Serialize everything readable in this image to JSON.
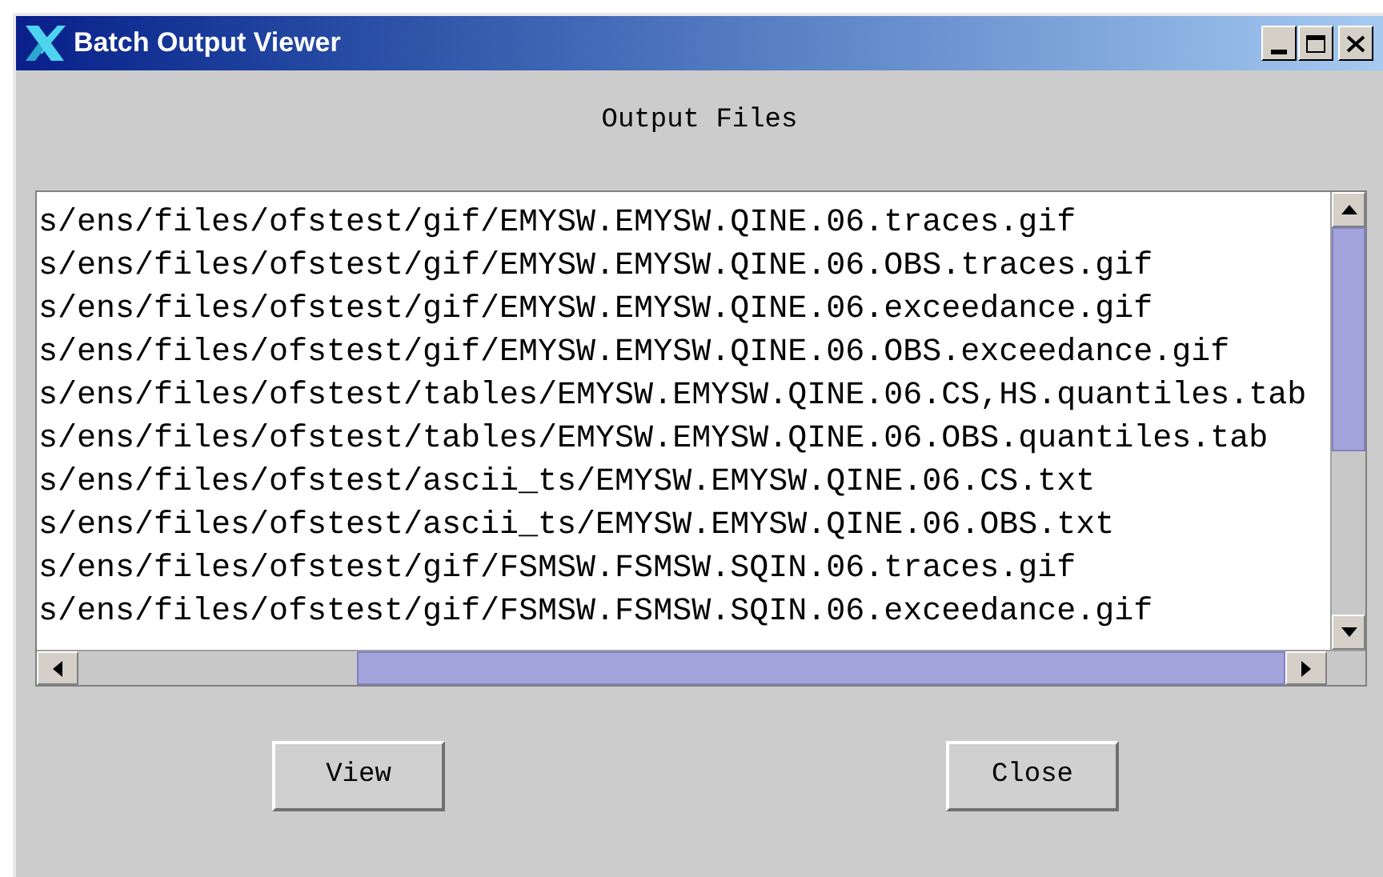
{
  "window": {
    "title": "Batch Output Viewer"
  },
  "heading": "Output Files",
  "files": [
    "s/ens/files/ofstest/gif/EMYSW.EMYSW.QINE.06.traces.gif",
    "s/ens/files/ofstest/gif/EMYSW.EMYSW.QINE.06.OBS.traces.gif",
    "s/ens/files/ofstest/gif/EMYSW.EMYSW.QINE.06.exceedance.gif",
    "s/ens/files/ofstest/gif/EMYSW.EMYSW.QINE.06.OBS.exceedance.gif",
    "s/ens/files/ofstest/tables/EMYSW.EMYSW.QINE.06.CS,HS.quantiles.tab",
    "s/ens/files/ofstest/tables/EMYSW.EMYSW.QINE.06.OBS.quantiles.tab",
    "s/ens/files/ofstest/ascii_ts/EMYSW.EMYSW.QINE.06.CS.txt",
    "s/ens/files/ofstest/ascii_ts/EMYSW.EMYSW.QINE.06.OBS.txt",
    "s/ens/files/ofstest/gif/FSMSW.FSMSW.SQIN.06.traces.gif",
    "s/ens/files/ofstest/gif/FSMSW.FSMSW.SQIN.06.exceedance.gif"
  ],
  "buttons": [
    "View",
    "Close"
  ]
}
